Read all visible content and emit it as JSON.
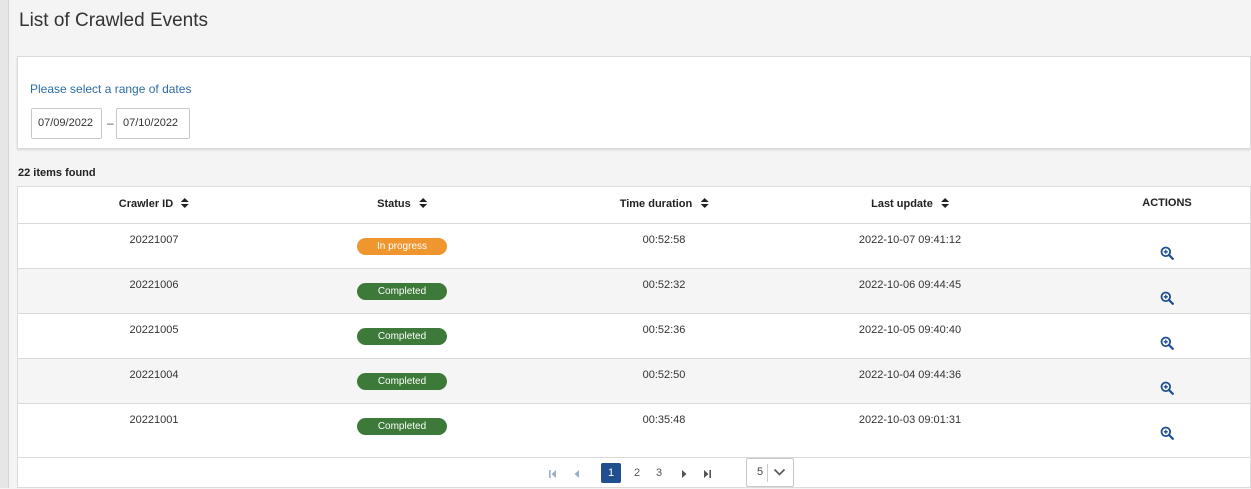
{
  "page": {
    "title": "List of Crawled Events"
  },
  "filter": {
    "label": "Please select a range of dates",
    "date_from": "07/09/2022",
    "separator": "–",
    "date_to": "07/10/2022"
  },
  "results": {
    "count_text": "22 items found"
  },
  "table": {
    "headers": {
      "crawler_id": "Crawler ID",
      "status": "Status",
      "duration": "Time duration",
      "last_update": "Last update",
      "actions": "ACTIONS"
    },
    "rows": [
      {
        "crawler_id": "20221007",
        "status": "In progress",
        "duration": "00:52:58",
        "last_update": "2022-10-07 09:41:12"
      },
      {
        "crawler_id": "20221006",
        "status": "Completed",
        "duration": "00:52:32",
        "last_update": "2022-10-06 09:44:45"
      },
      {
        "crawler_id": "20221005",
        "status": "Completed",
        "duration": "00:52:36",
        "last_update": "2022-10-05 09:40:40"
      },
      {
        "crawler_id": "20221004",
        "status": "Completed",
        "duration": "00:52:50",
        "last_update": "2022-10-04 09:44:36"
      },
      {
        "crawler_id": "20221001",
        "status": "Completed",
        "duration": "00:35:48",
        "last_update": "2022-10-03 09:01:31"
      }
    ]
  },
  "pagination": {
    "pages": [
      "1",
      "2",
      "3"
    ],
    "current": "1",
    "page_size": "5"
  },
  "colors": {
    "in_progress": "#f0962f",
    "completed": "#3d7a3a",
    "action_icon": "#1f4f8f",
    "link": "#2e6ca4"
  },
  "icons": {
    "sort": "sort-icon",
    "action": "zoom-in-icon",
    "first": "first-page-icon",
    "prev": "prev-page-icon",
    "next": "next-page-icon",
    "last": "last-page-icon",
    "dropdown": "chevron-down-icon"
  }
}
